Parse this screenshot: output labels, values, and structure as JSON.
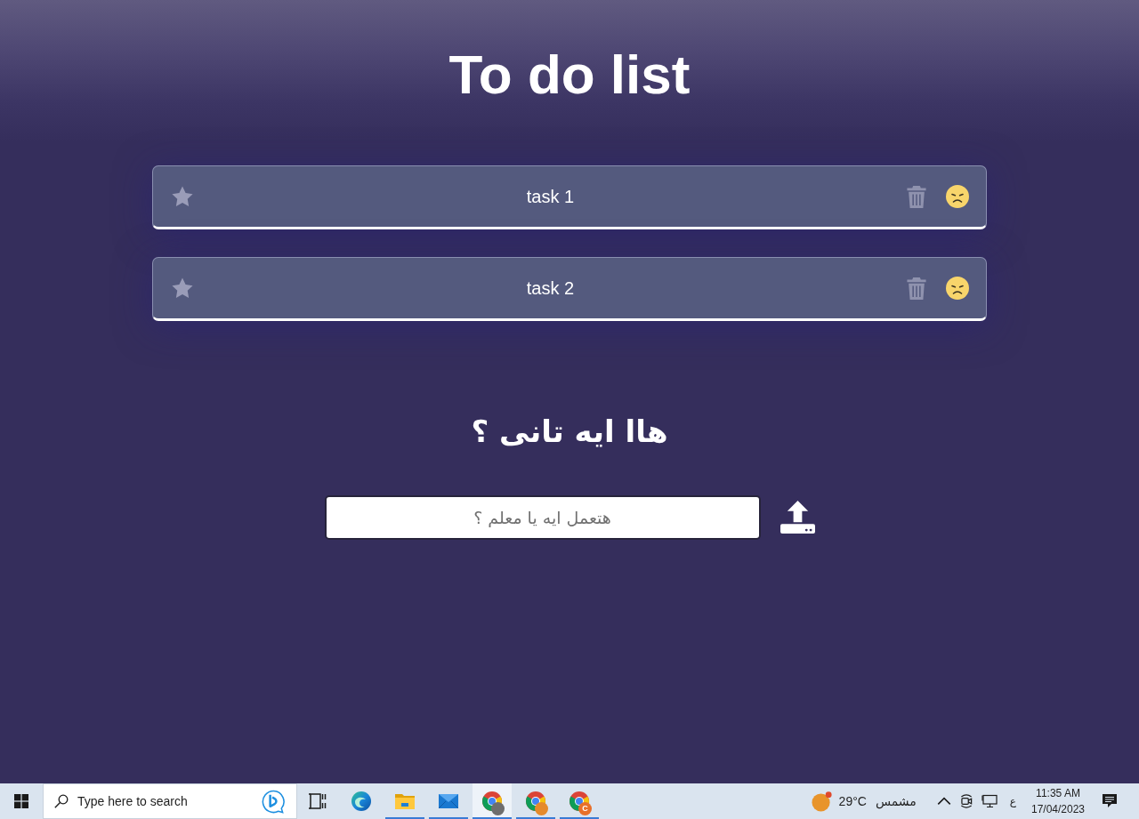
{
  "title": "To do list",
  "tasks": [
    {
      "text": "task 1",
      "starred": false,
      "done": false
    },
    {
      "text": "task 2",
      "starred": false,
      "done": false
    }
  ],
  "new_task": {
    "heading": "هاا ايه تانى ؟",
    "placeholder": "هتعمل ايه يا معلم ؟"
  },
  "taskbar": {
    "search_placeholder": "Type here to search",
    "apps": [
      {
        "kind": "taskview",
        "running": false,
        "selected": false
      },
      {
        "kind": "edge",
        "running": false,
        "selected": false
      },
      {
        "kind": "explorer",
        "running": true,
        "selected": false
      },
      {
        "kind": "mail",
        "running": true,
        "selected": false
      },
      {
        "kind": "chrome",
        "running": true,
        "selected": true,
        "profile": {
          "kind": "photo",
          "color": "#6e6e6e"
        }
      },
      {
        "kind": "chrome",
        "running": true,
        "selected": false,
        "profile": {
          "kind": "photo",
          "color": "#e58a2c"
        }
      },
      {
        "kind": "chrome",
        "running": true,
        "selected": false,
        "profile": {
          "kind": "letter",
          "text": "C",
          "color": "#e8702a"
        }
      }
    ],
    "tray": {
      "temperature": "29°C",
      "weather": "مشمس",
      "language": "ع",
      "time": "11:35 AM",
      "date": "17/04/2023"
    }
  }
}
